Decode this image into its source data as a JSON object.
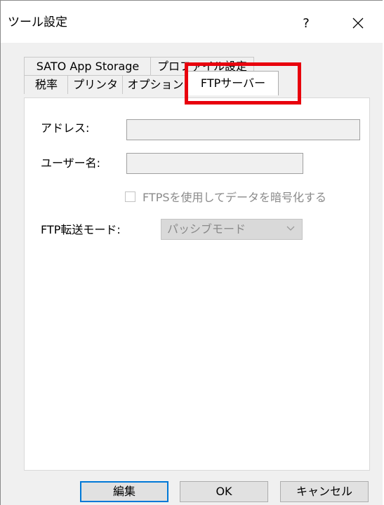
{
  "window": {
    "title": "ツール設定",
    "help_label": "?"
  },
  "tabs": {
    "top_row": [
      "SATO App Storage",
      "プロファイル設定"
    ],
    "bottom_row": [
      "税率",
      "プリンタ",
      "オプション",
      "FTPサーバー"
    ],
    "active": "FTPサーバー"
  },
  "ftp": {
    "address_label": "アドレス:",
    "address_value": "",
    "username_label": "ユーザー名:",
    "username_value": "",
    "ftps_checkbox_label": "FTPSを使用してデータを暗号化する",
    "ftps_checked": false,
    "mode_label": "FTP転送モード:",
    "mode_value": "パッシブモード"
  },
  "buttons": {
    "edit": "編集",
    "ok": "OK",
    "cancel": "キャンセル"
  },
  "colors": {
    "highlight": "#e8000d",
    "focus_border": "#0078d7"
  }
}
